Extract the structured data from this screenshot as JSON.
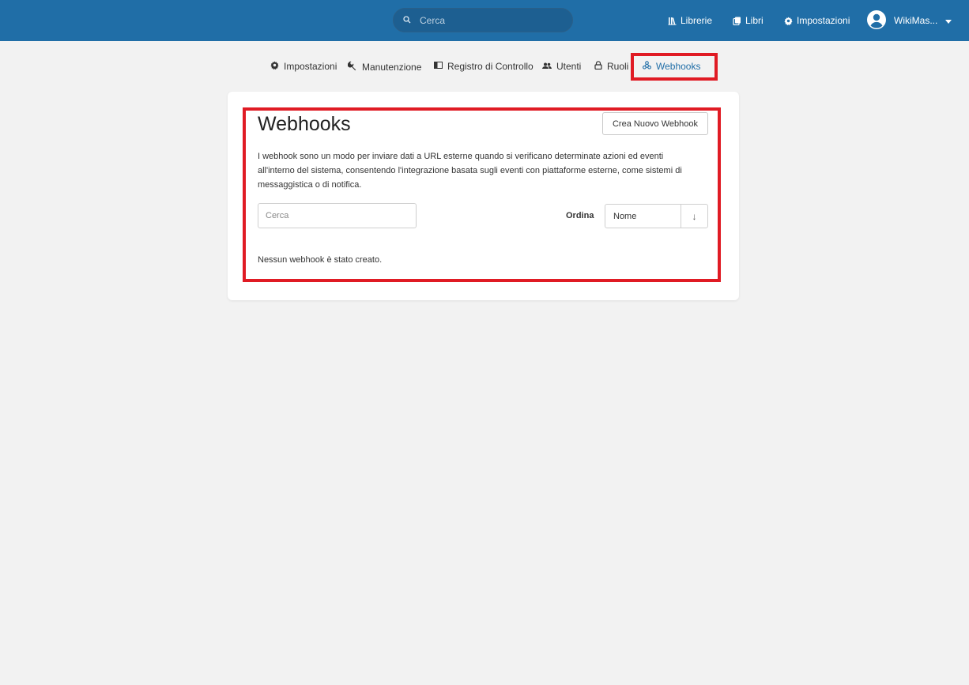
{
  "header": {
    "search_placeholder": "Cerca",
    "nav": [
      {
        "label": "Librerie",
        "icon": "shelves-icon"
      },
      {
        "label": "Libri",
        "icon": "books-icon"
      },
      {
        "label": "Impostazioni",
        "icon": "gear-icon"
      }
    ],
    "user_name": "WikiMas..."
  },
  "subnav": {
    "items": [
      {
        "label": "Impostazioni",
        "icon": "gear-icon"
      },
      {
        "label": "Manutenzione",
        "icon": "wrench-icon"
      },
      {
        "label": "Registro di Controllo",
        "icon": "audit-log-icon"
      },
      {
        "label": "Utenti",
        "icon": "users-icon"
      },
      {
        "label": "Ruoli",
        "icon": "lock-icon"
      },
      {
        "label": "Webhooks",
        "icon": "webhook-icon"
      }
    ],
    "active": "Webhooks"
  },
  "main": {
    "title": "Webhooks",
    "create_button": "Crea Nuovo Webhook",
    "description": "I webhook sono un modo per inviare dati a URL esterne quando si verificano determinate azioni ed eventi all'interno del sistema, consentendo l'integrazione basata sugli eventi con piattaforme esterne, come sistemi di messaggistica o di notifica.",
    "search_placeholder": "Cerca",
    "sort_label": "Ordina",
    "sort_value": "Nome",
    "sort_direction": "↓",
    "empty_message": "Nessun webhook è stato creato."
  },
  "colors": {
    "header_bg": "#206ea7",
    "accent": "#206ea7",
    "highlight": "#e01b24",
    "page_bg": "#f2f2f2"
  }
}
